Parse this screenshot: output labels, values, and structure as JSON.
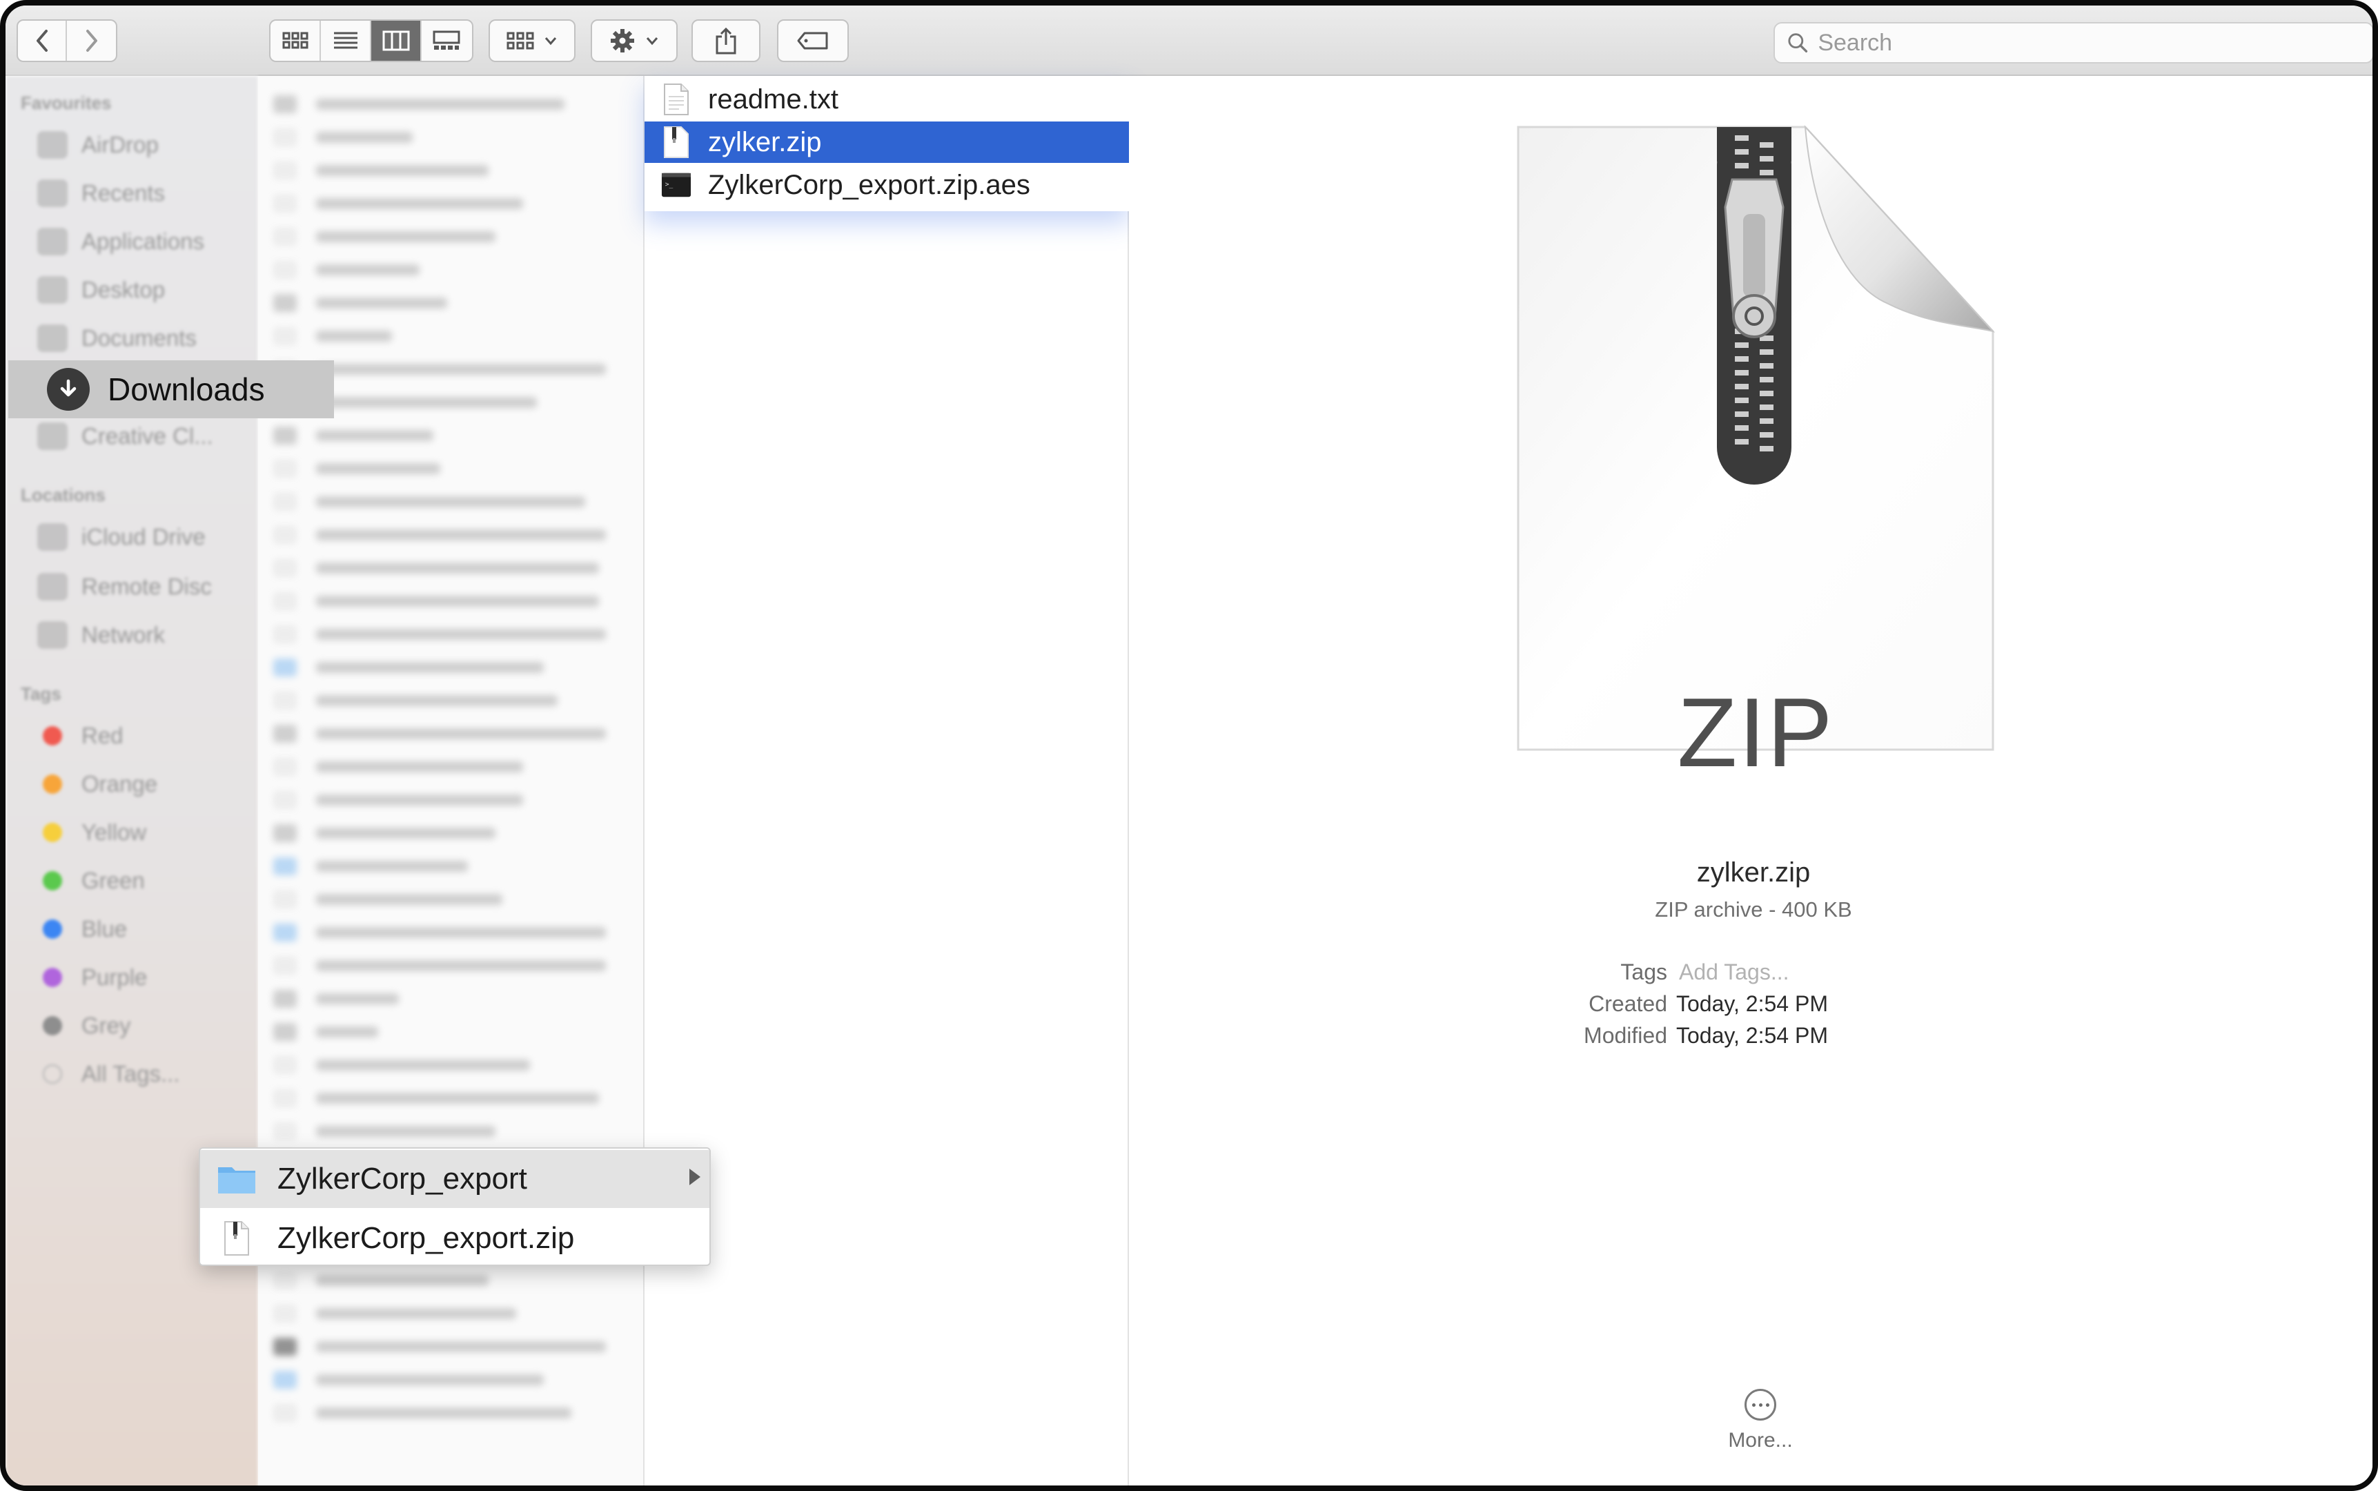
{
  "toolbar": {
    "back_icon": "chevron-left-icon",
    "forward_icon": "chevron-right-icon",
    "view_modes": [
      "icon-view",
      "list-view",
      "column-view",
      "gallery-view"
    ],
    "active_view": "column-view",
    "search_placeholder": "Search"
  },
  "sidebar": {
    "favourites_heading": "Favourites",
    "favourites": [
      "AirDrop",
      "Recents",
      "Applications",
      "Desktop",
      "Documents",
      "Downloads",
      "Creative Cl..."
    ],
    "selected": "Downloads",
    "locations_heading": "Locations",
    "locations": [
      "iCloud Drive",
      "Remote Disc",
      "Network"
    ],
    "tags_heading": "Tags",
    "tags": [
      {
        "label": "Red",
        "color": "#f05a50"
      },
      {
        "label": "Orange",
        "color": "#f7a53a"
      },
      {
        "label": "Yellow",
        "color": "#f6cf3c"
      },
      {
        "label": "Green",
        "color": "#5bc94e"
      },
      {
        "label": "Blue",
        "color": "#3c86f3"
      },
      {
        "label": "Purple",
        "color": "#b065dd"
      },
      {
        "label": "Grey",
        "color": "#8e8e8e"
      }
    ],
    "all_tags": "All Tags..."
  },
  "column2": {
    "files": [
      {
        "name": "readme.txt",
        "icon": "text-file-icon"
      },
      {
        "name": "zylker.zip",
        "icon": "zip-file-icon",
        "selected": true
      },
      {
        "name": "ZylkerCorp_export.zip.aes",
        "icon": "terminal-file-icon"
      }
    ],
    "selection_color": "#2f64d2"
  },
  "preview": {
    "doc_label": "ZIP",
    "file_name": "zylker.zip",
    "kind": "ZIP archive - 400 KB",
    "tags_label": "Tags",
    "tags_placeholder": "Add Tags...",
    "created_label": "Created",
    "created_value": "Today, 2:54 PM",
    "modified_label": "Modified",
    "modified_value": "Today, 2:54 PM",
    "more_label": "More..."
  },
  "popup": {
    "items": [
      {
        "label": "ZylkerCorp_export",
        "icon": "folder-icon",
        "has_submenu": true
      },
      {
        "label": "ZylkerCorp_export.zip",
        "icon": "zip-file-icon"
      }
    ]
  }
}
